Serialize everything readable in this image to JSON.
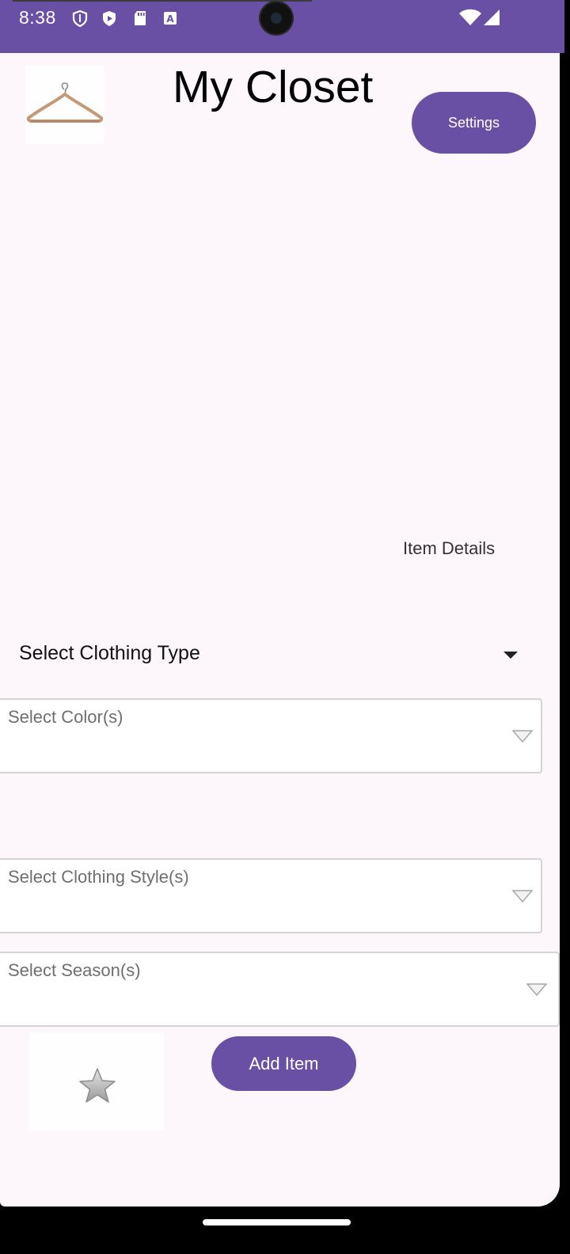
{
  "status_bar": {
    "time": "8:38",
    "icons": [
      "shield-icon",
      "play-protect-icon",
      "sd-card-icon",
      "text-a-icon"
    ],
    "right_icons": [
      "wifi-icon",
      "signal-icon"
    ],
    "color": "#6a50a5"
  },
  "header": {
    "logo_icon": "hanger-icon",
    "title": "My Closet",
    "settings_label": "Settings"
  },
  "form": {
    "item_details_label": "Item Details",
    "clothing_type_label": "Select Clothing Type",
    "color_label": "Select Color(s)",
    "style_label": "Select Clothing Style(s)",
    "season_label": "Select Season(s)",
    "favorite_icon": "star-icon",
    "add_label": "Add Item"
  },
  "theme": {
    "accent": "#6a50a5",
    "background": "#fdf7fc"
  }
}
